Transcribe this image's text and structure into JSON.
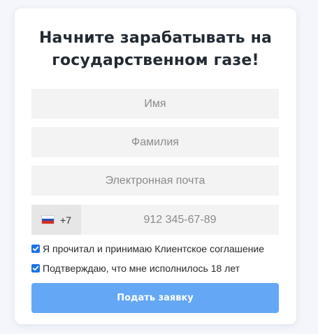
{
  "form": {
    "title_line1": "Начните зарабатывать на",
    "title_line2": "государственном газе!",
    "first_name_placeholder": "Имя",
    "last_name_placeholder": "Фамилия",
    "email_placeholder": "Электронная почта",
    "phone": {
      "country_flag": "russia-flag-icon",
      "dial_code": "+7",
      "placeholder": "912 345-67-89"
    },
    "consents": [
      {
        "label": "Я прочитал и принимаю Клиентское соглашение",
        "checked": true
      },
      {
        "label": "Подтверждаю, что мне исполнилось 18 лет",
        "checked": true
      }
    ],
    "submit_label": "Подать заявку"
  },
  "colors": {
    "page_background": "#f4f6fb",
    "card_background": "#ffffff",
    "input_background": "#f3f3f3",
    "checkbox_accent": "#1a73e8",
    "submit_background": "#64a8f5",
    "title_text": "#222a33"
  }
}
